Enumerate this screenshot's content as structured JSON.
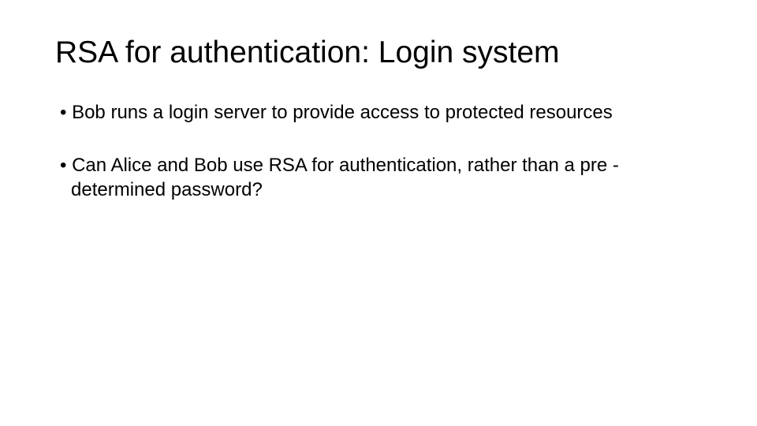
{
  "slide": {
    "title": "RSA for authentication: Login system",
    "bullets": [
      "Bob runs a login server to provide access to protected resources",
      "Can Alice and Bob use RSA for authentication, rather than a pre -determined password?"
    ]
  }
}
